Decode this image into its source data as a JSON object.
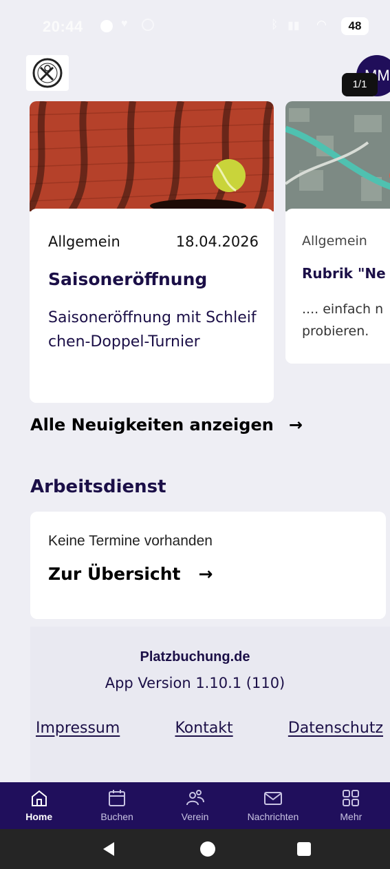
{
  "status_bar": {
    "time": "20:44",
    "battery": "48"
  },
  "header": {
    "avatar_initials": "MM",
    "pager": "1/1"
  },
  "news": [
    {
      "category": "Allgemein",
      "date": "18.04.2026",
      "title": "Saisoneröffnung",
      "text": "Saisoneröffnung mit Schleifchen-Doppel-Turnier"
    },
    {
      "category": "Allgemein",
      "title": "Rubrik \"Ne",
      "text": ".... einfach n probieren."
    }
  ],
  "all_news": {
    "label": "Alle Neuigkeiten anzeigen",
    "arrow": "→"
  },
  "work_duty": {
    "title": "Arbeitsdienst",
    "empty_text": "Keine Termine vorhanden",
    "overview_label": "Zur Übersicht",
    "arrow": "→"
  },
  "footer": {
    "brand": "Platzbuchung.de",
    "version": "App Version 1.10.1 (110)",
    "links": [
      "Impressum",
      "Kontakt",
      "Datenschutz"
    ]
  },
  "bottom_nav": [
    {
      "label": "Home",
      "icon": "home-icon",
      "active": true
    },
    {
      "label": "Buchen",
      "icon": "calendar-icon",
      "active": false
    },
    {
      "label": "Verein",
      "icon": "people-icon",
      "active": false
    },
    {
      "label": "Nachrichten",
      "icon": "mail-icon",
      "active": false
    },
    {
      "label": "Mehr",
      "icon": "grid-icon",
      "active": false
    }
  ],
  "colors": {
    "primary": "#200f5c",
    "title": "#1b0f47",
    "background": "#eeeef4"
  }
}
